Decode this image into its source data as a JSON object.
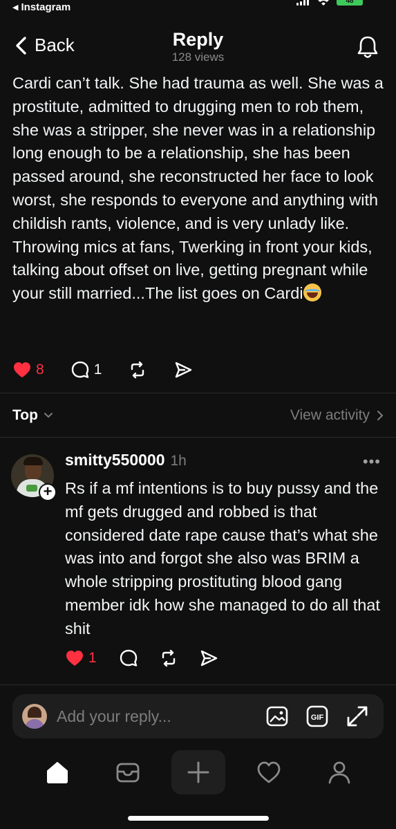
{
  "status_bar": {
    "back_label": "Instagram",
    "battery": "48"
  },
  "header": {
    "back_label": "Back",
    "title": "Reply",
    "views": "128 views"
  },
  "post": {
    "text": "Cardi can’t talk. She had trauma as well. She was a prostitute, admitted to drugging men to rob them, she was a stripper, she never was in a relationship long enough to be a relationship, she has been passed around, she reconstructed her face to look worst, she responds to everyone and anything with childish rants, violence, and is very unlady like. Throwing mics at fans, Twerking in front your kids, talking about offset on live, getting pregnant while your still married...The list goes on Cardi",
    "emoji": "face-with-tears-of-joy",
    "likes": "8",
    "replies": "1"
  },
  "sort": {
    "label": "Top",
    "activity_label": "View activity"
  },
  "reply": {
    "username": "smitty550000",
    "time": "1h",
    "text": "Rs if a mf intentions is to buy pussy and the mf gets drugged and robbed is that considered date rape cause that’s what she was into and forgot she also was BRIM a whole stripping prostituting blood gang member idk how she managed to do all that shit",
    "likes": "1"
  },
  "composer": {
    "placeholder": "Add your reply..."
  },
  "tabs": [
    "home",
    "inbox",
    "create",
    "activity",
    "profile"
  ],
  "colors": {
    "background": "#101010",
    "like_red": "#ff3040",
    "muted": "#7d7d7d"
  }
}
